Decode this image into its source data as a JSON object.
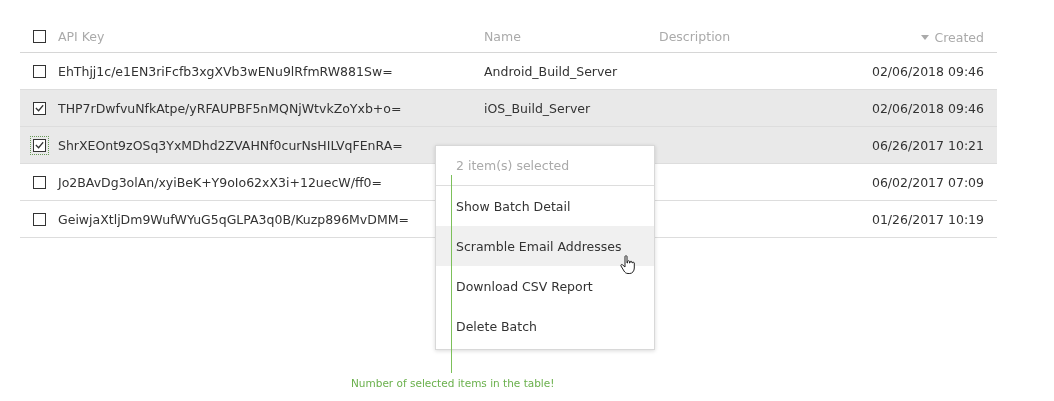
{
  "table": {
    "select_all": {
      "checked": false
    },
    "columns": [
      {
        "label": "API Key",
        "sorted": false
      },
      {
        "label": "Name",
        "sorted": false
      },
      {
        "label": "Description",
        "sorted": false
      },
      {
        "label": "Created",
        "sorted": true
      }
    ],
    "rows": [
      {
        "api_key": "EhThjj1c/e1EN3riFcfb3xgXVb3wENu9lRfmRW881Sw=",
        "name": "Android_Build_Server",
        "created": "02/06/2018 09:46",
        "checked": false,
        "focused": false
      },
      {
        "api_key": "THP7rDwfvuNfkAtpe/yRFAUPBF5nMQNjWtvkZoYxb+o=",
        "name": "iOS_Build_Server",
        "created": "02/06/2018 09:46",
        "checked": true,
        "focused": false
      },
      {
        "api_key": "ShrXEOnt9zOSq3YxMDhd2ZVAHNf0curNsHILVqFEnRA=",
        "created": "06/26/2017 10:21",
        "checked": true,
        "focused": true
      },
      {
        "api_key": "Jo2BAvDg3olAn/xyiBeK+Y9oIo62xX3i+12uecW/ff0=",
        "created": "06/02/2017 07:09",
        "checked": false,
        "focused": false
      },
      {
        "api_key": "GeiwjaXtljDm9WufWYuG5qGLPA3q0B/Kuzp896MvDMM=",
        "created": "01/26/2017 10:19",
        "checked": false,
        "focused": false
      }
    ]
  },
  "context_menu": {
    "header": "2 item(s) selected",
    "items": [
      {
        "label": "Show Batch Detail",
        "highlighted": false
      },
      {
        "label": "Scramble Email Addresses",
        "highlighted": true
      },
      {
        "label": "Download CSV Report",
        "highlighted": false
      },
      {
        "label": "Delete Batch",
        "highlighted": false
      }
    ]
  },
  "annotation": {
    "text": "Number of selected items in the table!"
  }
}
